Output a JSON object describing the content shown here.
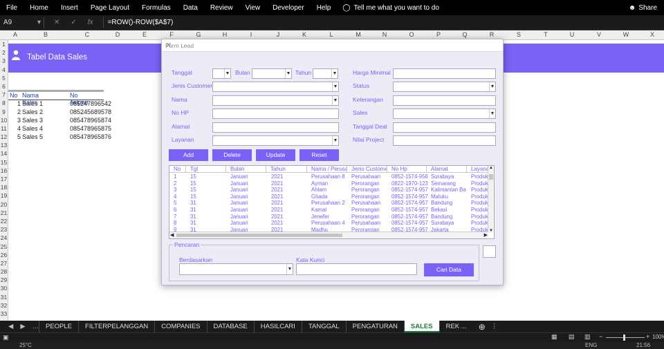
{
  "ribbon": {
    "menus": [
      "File",
      "Home",
      "Insert",
      "Page Layout",
      "Formulas",
      "Data",
      "Review",
      "View",
      "Developer",
      "Help"
    ],
    "tell": "Tell me what you want to do",
    "share": "Share"
  },
  "formula_bar": {
    "name_box": "A9",
    "formula": "=ROW()-ROW($A$7)"
  },
  "columns": [
    "A",
    "B",
    "C",
    "D",
    "E",
    "F",
    "G",
    "H",
    "I",
    "J",
    "K",
    "L",
    "M",
    "N",
    "O",
    "P",
    "Q",
    "R",
    "S",
    "T",
    "U",
    "V",
    "W",
    "X"
  ],
  "rows": [
    "1",
    "2",
    "3",
    "4",
    "5",
    "6",
    "7",
    "8",
    "9",
    "10",
    "11",
    "12",
    "13",
    "14",
    "15",
    "16",
    "17",
    "18",
    "19",
    "20",
    "21",
    "22",
    "23",
    "24",
    "25",
    "26",
    "27",
    "28",
    "29",
    "30",
    "31",
    "32",
    "33"
  ],
  "banner": {
    "title": "Tabel  Data Sales",
    "color": "#7b61f5"
  },
  "sales_table": {
    "headers": [
      "No",
      "Nama Sales",
      "No Telpon"
    ],
    "rows": [
      {
        "no": "1",
        "name": "Sales 1",
        "phone": "085247896542"
      },
      {
        "no": "2",
        "name": "Sales 2",
        "phone": "085245689578"
      },
      {
        "no": "3",
        "name": "Sales 3",
        "phone": "085478965874"
      },
      {
        "no": "4",
        "name": "Sales 4",
        "phone": "085478965875"
      },
      {
        "no": "5",
        "name": "Sales 5",
        "phone": "085478965876"
      }
    ]
  },
  "form": {
    "title": "Form Lead",
    "labels": {
      "tanggal": "Tanggal",
      "bulan": "Bulan",
      "tahun": "Tahun",
      "jenis": "Jenis Customer",
      "nama": "Nama",
      "nohp": "No HP",
      "alamat": "Alamat",
      "layanan": "Layanan",
      "harga": "Harga Minimal",
      "status": "Status",
      "keterangan": "Keterangan",
      "sales": "Sales",
      "tgl_deal": "Tanggal Deal",
      "nilai": "Nilai Project"
    },
    "buttons": {
      "add": "Add",
      "delete": "Delete",
      "update": "Update",
      "reset": "Reset"
    },
    "grid_headers": [
      "No",
      "Tgl",
      "Bulan",
      "Tahun",
      "Nama / Perusa",
      "Jenis Custome",
      "No Hp",
      "Alamat",
      "Layanan"
    ],
    "grid_rows": [
      [
        "1",
        "15",
        "Januari",
        "2021",
        "Perusahaan 8",
        "Perusahaan",
        "0852-1574-956",
        "Surabaya",
        "Produk"
      ],
      [
        "2",
        "15",
        "Januari",
        "2021",
        "Ayman",
        "Perorangan",
        "0822-1970-123",
        "Semarang",
        "Produk"
      ],
      [
        "3",
        "15",
        "Januari",
        "2021",
        "Ahlam",
        "Perorangan",
        "0852-1574-957",
        "Kalimantan Ba",
        "Produk"
      ],
      [
        "4",
        "15",
        "Januari",
        "2021",
        "Ghada",
        "Perorangan",
        "0852-1574-957",
        "Maluku",
        "Produk"
      ],
      [
        "5",
        "31",
        "Januari",
        "2021",
        "Perusahaan 2",
        "Perusahaan",
        "0852-1574-957",
        "Bandung",
        "Produk"
      ],
      [
        "6",
        "31",
        "Januari",
        "2021",
        "Kamal",
        "Perorangan",
        "0852-1574-957",
        "Bekasi",
        "Produk"
      ],
      [
        "7",
        "31",
        "Januari",
        "2021",
        "Jenefer",
        "Perorangan",
        "0852-1574-957",
        "Bandung",
        "Produk"
      ],
      [
        "8",
        "31",
        "Januari",
        "2021",
        "Perusahaan 4",
        "Perusahaan",
        "0852-1574-957",
        "Surabaya",
        "Produk"
      ],
      [
        "9",
        "31",
        "Januari",
        "2021",
        "Madhu",
        "Perorangan",
        "0852-1574-957",
        "Jakarta",
        "Produk"
      ]
    ],
    "search": {
      "frame": "Pencaran",
      "berdasarkan": "Berdasarkan",
      "kata_kunci": "Kata Kunci",
      "cari": "Cari Data"
    }
  },
  "sheet_tabs": [
    "PEOPLE",
    "FILTERPELANGGAN",
    "COMPANIES",
    "DATABASE",
    "HASILCARI",
    "TANGGAL",
    "PENGATURAN",
    "SALES",
    "REK ..."
  ],
  "active_tab": "SALES",
  "status": {
    "zoom": "100%",
    "lang": "ENG",
    "time": "21:56",
    "temp": "25°C"
  }
}
